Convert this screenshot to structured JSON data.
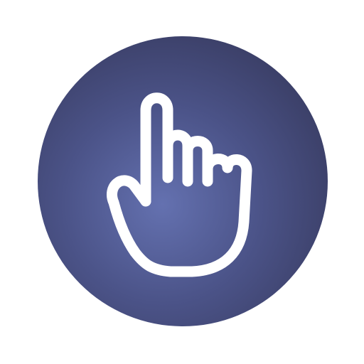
{
  "icon": {
    "name": "pointing-hand-icon",
    "colors": {
      "background": "#ffffff",
      "circle_center": "#6471b0",
      "circle_mid": "#4b5388",
      "circle_edge": "#3b3f67",
      "stroke": "#ffffff"
    }
  }
}
